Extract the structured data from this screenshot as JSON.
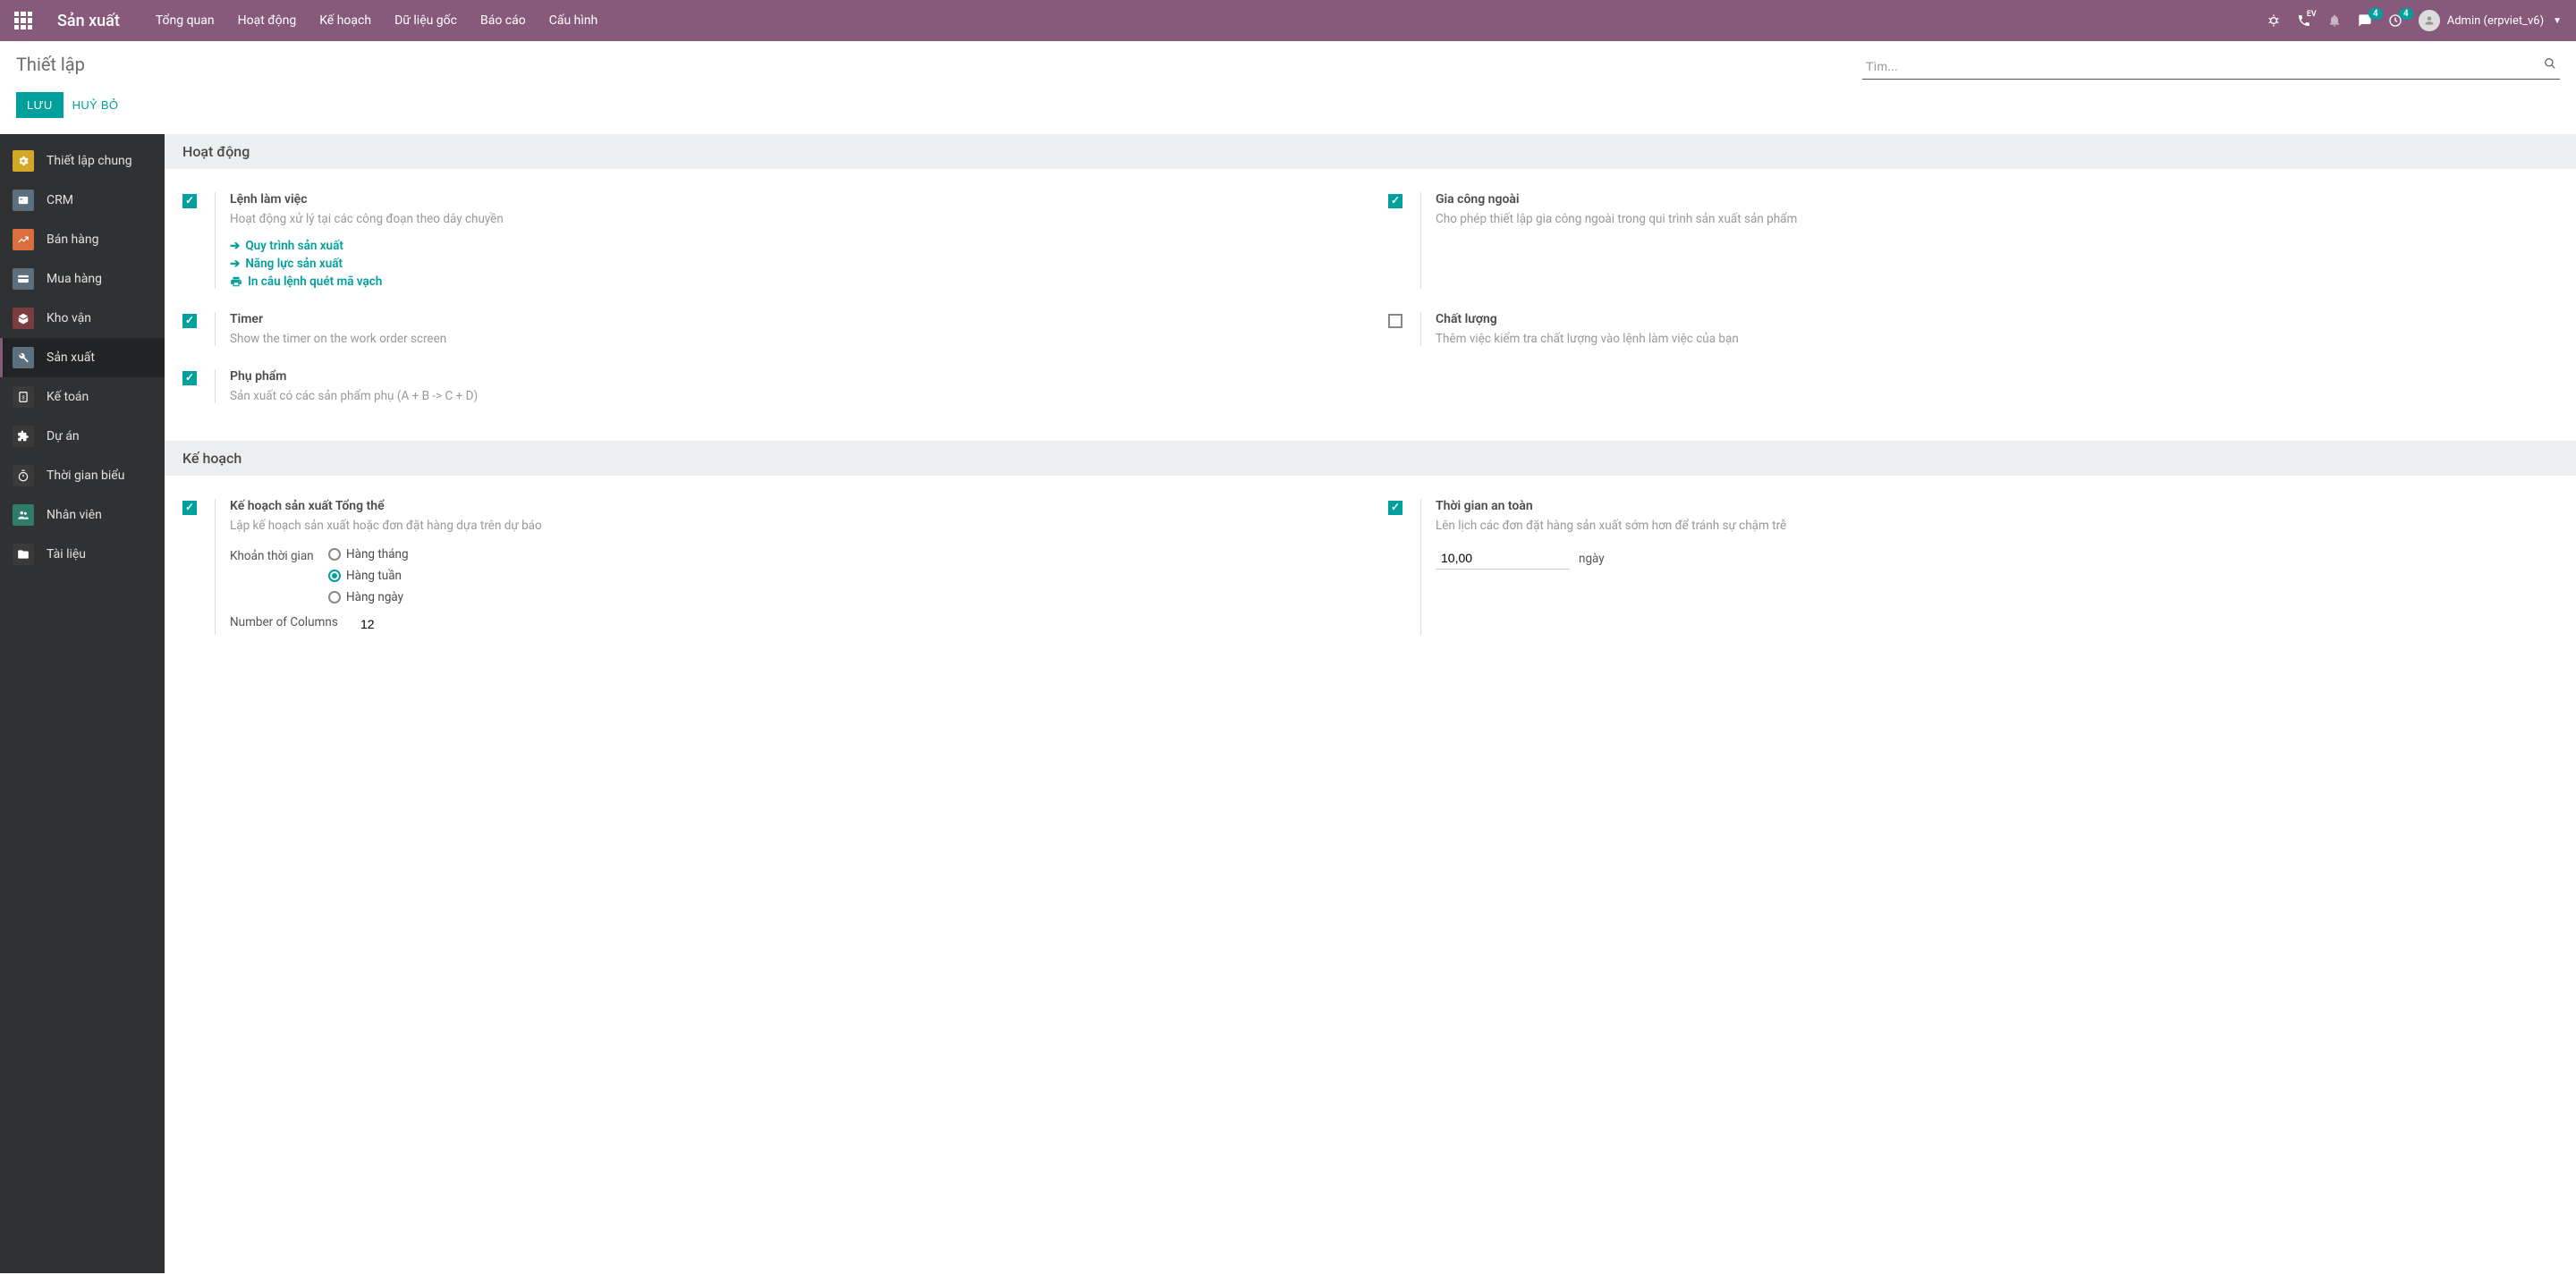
{
  "brand": "Sản xuất",
  "topmenu": [
    "Tổng quan",
    "Hoạt động",
    "Kế hoạch",
    "Dữ liệu gốc",
    "Báo cáo",
    "Cấu hình"
  ],
  "topright": {
    "badge_msg": "4",
    "badge_clock": "4",
    "user": "Admin (erpviet_v6)"
  },
  "breadcrumb": "Thiết lập",
  "search_placeholder": "Tìm...",
  "buttons": {
    "save": "LƯU",
    "discard": "HUỶ BỎ"
  },
  "sidebar": [
    {
      "label": "Thiết lập chung",
      "color": "#d4a727",
      "icon": "gear"
    },
    {
      "label": "CRM",
      "color": "#5c6f7e",
      "icon": "card"
    },
    {
      "label": "Bán hàng",
      "color": "#d96f3e",
      "icon": "chart"
    },
    {
      "label": "Mua hàng",
      "color": "#5c6f7e",
      "icon": "credit"
    },
    {
      "label": "Kho vận",
      "color": "#7a3e3e",
      "icon": "box"
    },
    {
      "label": "Sản xuất",
      "color": "#5c6f7e",
      "icon": "wrench"
    },
    {
      "label": "Kế toán",
      "color": "#3a3a3a",
      "icon": "doc"
    },
    {
      "label": "Dự án",
      "color": "#3a3a3a",
      "icon": "puzzle"
    },
    {
      "label": "Thời gian biểu",
      "color": "#3a3a3a",
      "icon": "stopwatch"
    },
    {
      "label": "Nhân viên",
      "color": "#2e7d6b",
      "icon": "people"
    },
    {
      "label": "Tài liệu",
      "color": "#3a3a3a",
      "icon": "folder"
    }
  ],
  "sidebar_active_index": 5,
  "sections": {
    "activity": {
      "title": "Hoạt động",
      "work_orders": {
        "title": "Lệnh làm việc",
        "desc": "Hoạt động xử lý tại các công đoạn theo dây chuyền",
        "link1": "Quy trình sản xuất",
        "link2": "Năng lực sản xuất",
        "link3": "In câu lệnh quét mã vạch"
      },
      "subcontract": {
        "title": "Gia công ngoài",
        "desc": "Cho phép thiết lập gia công ngoài trong qui trình sản xuất sản phẩm"
      },
      "timer": {
        "title": "Timer",
        "desc": "Show the timer on the work order screen"
      },
      "quality": {
        "title": "Chất lượng",
        "desc": "Thêm việc kiểm tra chất lượng vào lệnh làm việc của bạn"
      },
      "byproduct": {
        "title": "Phụ phẩm",
        "desc": "Sản xuất có các sản phẩm phụ (A + B -> C + D)"
      }
    },
    "plan": {
      "title": "Kế hoạch",
      "mps": {
        "title": "Kế hoạch sản xuất Tổng thể",
        "desc": "Lập kế hoạch sản xuất hoặc đơn đặt hàng dựa trên dự báo",
        "period_label": "Khoản thời gian",
        "period_options": [
          "Hàng tháng",
          "Hàng tuần",
          "Hàng ngày"
        ],
        "period_selected": 1,
        "cols_label": "Number of Columns",
        "cols_value": "12"
      },
      "safety": {
        "title": "Thời gian an toàn",
        "desc": "Lên lịch các đơn đặt hàng sản xuất sớm hơn để tránh sự chậm trễ",
        "value": "10,00",
        "unit": "ngày"
      }
    }
  }
}
